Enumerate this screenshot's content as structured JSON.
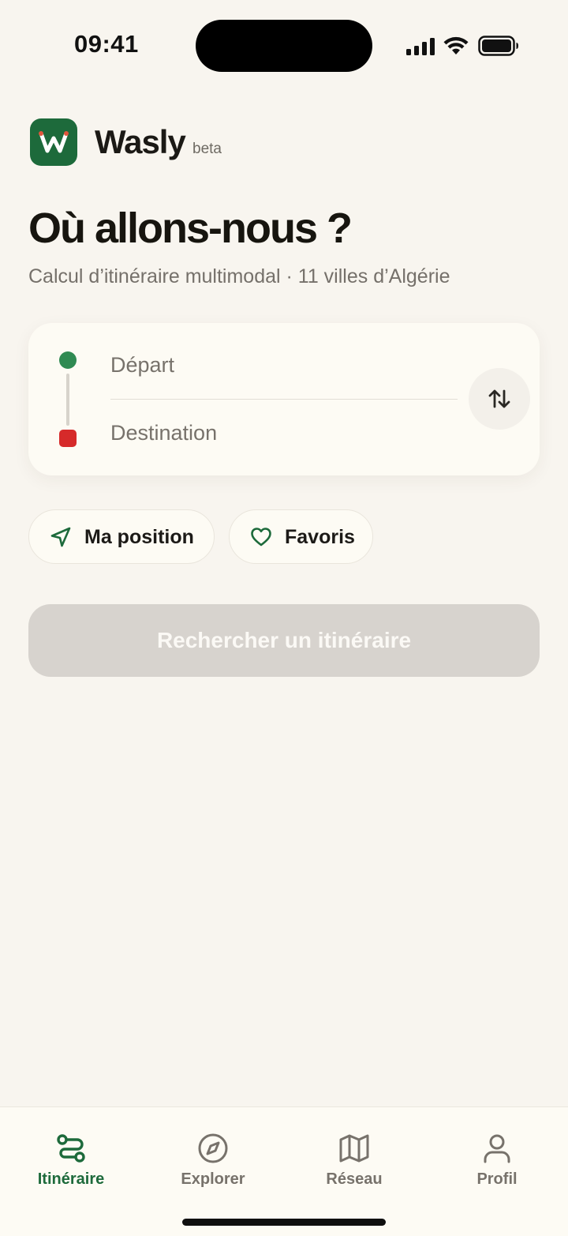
{
  "status_bar": {
    "time": "09:41"
  },
  "brand": {
    "name": "Wasly",
    "badge": "beta",
    "logo_letter": "W",
    "logo_color": "#1d6a3b"
  },
  "hero": {
    "title": "Où allons-nous ?",
    "subtitle": "Calcul d’itinéraire multimodal · 11 villes d’Algérie"
  },
  "route_form": {
    "departure_placeholder": "Départ",
    "departure_value": "",
    "destination_placeholder": "Destination",
    "destination_value": "",
    "start_color": "#2f8a52",
    "end_color": "#d62a2a",
    "swap_icon": "swap-vertical-icon"
  },
  "quick_actions": [
    {
      "label": "Ma position",
      "icon": "navigation-arrow-icon"
    },
    {
      "label": "Favoris",
      "icon": "heart-icon"
    }
  ],
  "search_button": {
    "label": "Rechercher un itinéraire",
    "state": "disabled"
  },
  "tab_bar": {
    "active_color": "#1d6a3b",
    "tabs": [
      {
        "label": "Itinéraire",
        "icon": "route-icon",
        "active": true
      },
      {
        "label": "Explorer",
        "icon": "compass-icon",
        "active": false
      },
      {
        "label": "Réseau",
        "icon": "map-icon",
        "active": false
      },
      {
        "label": "Profil",
        "icon": "user-icon",
        "active": false
      }
    ]
  }
}
